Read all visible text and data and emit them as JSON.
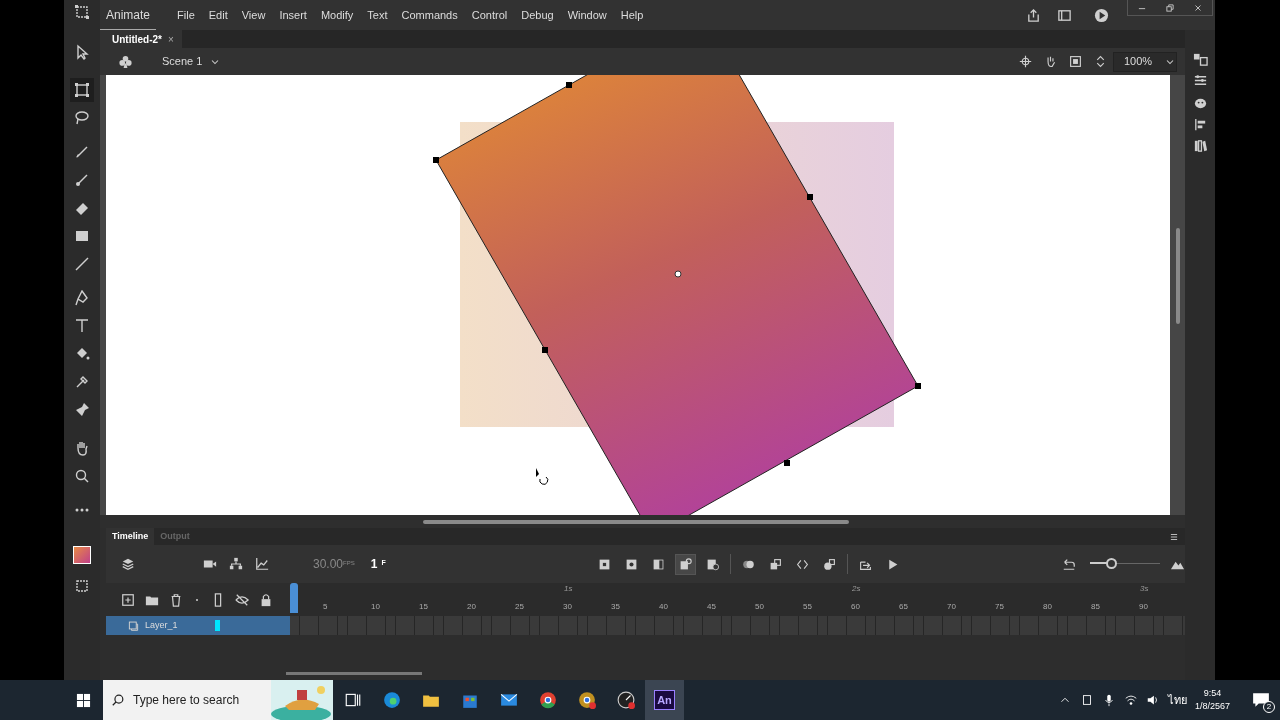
{
  "app": {
    "name": "Animate"
  },
  "menu": [
    "File",
    "Edit",
    "View",
    "Insert",
    "Modify",
    "Text",
    "Commands",
    "Control",
    "Debug",
    "Window",
    "Help"
  ],
  "document_tabs": [
    {
      "label": "Untitled-2*",
      "selected": true,
      "close": "×"
    }
  ],
  "edit_bar": {
    "scene": "Scene 1",
    "zoom": "100%"
  },
  "timeline": {
    "tabs": [
      {
        "label": "Timeline",
        "selected": true
      },
      {
        "label": "Output",
        "selected": false
      }
    ],
    "fps": "30.00",
    "fps_unit": "FPS",
    "frame": "1",
    "frame_unit": "F",
    "zoom_slider": {
      "level": 0.3
    },
    "seconds": [
      "1s",
      "2s",
      "3s"
    ],
    "frame_numbers": [
      "5",
      "10",
      "15",
      "20",
      "25",
      "30",
      "35",
      "40",
      "45",
      "50",
      "55",
      "60",
      "65",
      "70",
      "75",
      "80",
      "85",
      "90"
    ],
    "layers": [
      {
        "name": "Layer_1",
        "selected": true,
        "color": "#00e5ff"
      }
    ]
  },
  "taskbar": {
    "search_placeholder": "Type here to search",
    "app_badge": "An",
    "language": "ไทย",
    "time": "9:54",
    "date": "1/8/2567",
    "notifications": "2"
  }
}
